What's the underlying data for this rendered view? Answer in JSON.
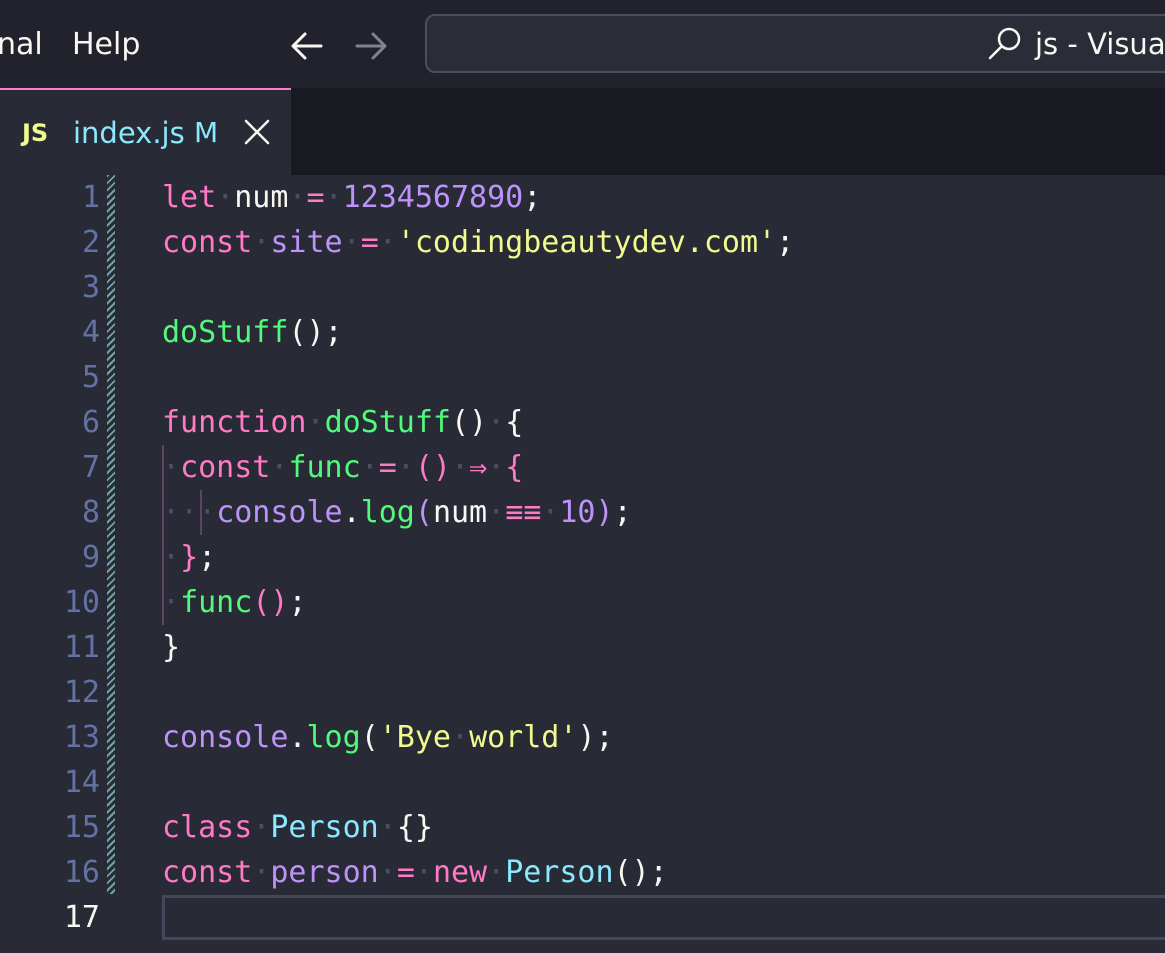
{
  "menu": {
    "partial_item": "nal",
    "help": "Help"
  },
  "command_center": {
    "title": "js - Visual"
  },
  "tab": {
    "icon_label": "JS",
    "filename": "index.js",
    "status": "M"
  },
  "editor": {
    "line_numbers": [
      "1",
      "2",
      "3",
      "4",
      "5",
      "6",
      "7",
      "8",
      "9",
      "10",
      "11",
      "12",
      "13",
      "14",
      "15",
      "16",
      "17"
    ],
    "active_line": "17",
    "lines": [
      [
        {
          "t": "let",
          "c": "kw"
        },
        {
          "t": "·",
          "c": "ws"
        },
        {
          "t": "num",
          "c": "plain"
        },
        {
          "t": "·",
          "c": "ws"
        },
        {
          "t": "=",
          "c": "kw"
        },
        {
          "t": "·",
          "c": "ws"
        },
        {
          "t": "1234567890",
          "c": "num"
        },
        {
          "t": ";",
          "c": "plain"
        }
      ],
      [
        {
          "t": "const",
          "c": "kw"
        },
        {
          "t": "·",
          "c": "ws"
        },
        {
          "t": "site",
          "c": "var"
        },
        {
          "t": "·",
          "c": "ws"
        },
        {
          "t": "=",
          "c": "kw"
        },
        {
          "t": "·",
          "c": "ws"
        },
        {
          "t": "'codingbeautydev.com'",
          "c": "str"
        },
        {
          "t": ";",
          "c": "plain"
        }
      ],
      [],
      [
        {
          "t": "doStuff",
          "c": "fn"
        },
        {
          "t": "();",
          "c": "plain"
        }
      ],
      [],
      [
        {
          "t": "function",
          "c": "kw"
        },
        {
          "t": "·",
          "c": "ws"
        },
        {
          "t": "doStuff",
          "c": "fn"
        },
        {
          "t": "()",
          "c": "plain"
        },
        {
          "t": "·",
          "c": "ws"
        },
        {
          "t": "{",
          "c": "plain"
        }
      ],
      [
        {
          "t": "·",
          "c": "ws"
        },
        {
          "t": "const",
          "c": "kw"
        },
        {
          "t": "·",
          "c": "ws"
        },
        {
          "t": "func",
          "c": "fn"
        },
        {
          "t": "·",
          "c": "ws"
        },
        {
          "t": "=",
          "c": "kw"
        },
        {
          "t": "·",
          "c": "ws"
        },
        {
          "t": "()",
          "c": "kw"
        },
        {
          "t": "·",
          "c": "ws"
        },
        {
          "t": "⇒",
          "c": "kw"
        },
        {
          "t": "·",
          "c": "ws"
        },
        {
          "t": "{",
          "c": "kw"
        }
      ],
      [
        {
          "t": "·",
          "c": "ws"
        },
        {
          "t": "·",
          "c": "ws"
        },
        {
          "t": "·",
          "c": "ws"
        },
        {
          "t": "console",
          "c": "var"
        },
        {
          "t": ".",
          "c": "plain"
        },
        {
          "t": "log",
          "c": "fn"
        },
        {
          "t": "(",
          "c": "var"
        },
        {
          "t": "num",
          "c": "plain"
        },
        {
          "t": "·",
          "c": "ws"
        },
        {
          "t": "≡≡",
          "c": "kw"
        },
        {
          "t": "·",
          "c": "ws"
        },
        {
          "t": "10",
          "c": "num"
        },
        {
          "t": ")",
          "c": "var"
        },
        {
          "t": ";",
          "c": "plain"
        }
      ],
      [
        {
          "t": "·",
          "c": "ws"
        },
        {
          "t": "}",
          "c": "kw"
        },
        {
          "t": ";",
          "c": "plain"
        }
      ],
      [
        {
          "t": "·",
          "c": "ws"
        },
        {
          "t": "func",
          "c": "fn"
        },
        {
          "t": "()",
          "c": "kw"
        },
        {
          "t": ";",
          "c": "plain"
        }
      ],
      [
        {
          "t": "}",
          "c": "plain"
        }
      ],
      [],
      [
        {
          "t": "console",
          "c": "var"
        },
        {
          "t": ".",
          "c": "plain"
        },
        {
          "t": "log",
          "c": "fn"
        },
        {
          "t": "(",
          "c": "plain"
        },
        {
          "t": "'Bye",
          "c": "str"
        },
        {
          "t": "·",
          "c": "ws"
        },
        {
          "t": "world'",
          "c": "str"
        },
        {
          "t": ");",
          "c": "plain"
        }
      ],
      [],
      [
        {
          "t": "class",
          "c": "kw"
        },
        {
          "t": "·",
          "c": "ws"
        },
        {
          "t": "Person",
          "c": "cls"
        },
        {
          "t": "·",
          "c": "ws"
        },
        {
          "t": "{}",
          "c": "plain"
        }
      ],
      [
        {
          "t": "const",
          "c": "kw"
        },
        {
          "t": "·",
          "c": "ws"
        },
        {
          "t": "person",
          "c": "var"
        },
        {
          "t": "·",
          "c": "ws"
        },
        {
          "t": "=",
          "c": "kw"
        },
        {
          "t": "·",
          "c": "ws"
        },
        {
          "t": "new",
          "c": "kw"
        },
        {
          "t": "·",
          "c": "ws"
        },
        {
          "t": "Person",
          "c": "cls"
        },
        {
          "t": "();",
          "c": "plain"
        }
      ],
      []
    ]
  }
}
